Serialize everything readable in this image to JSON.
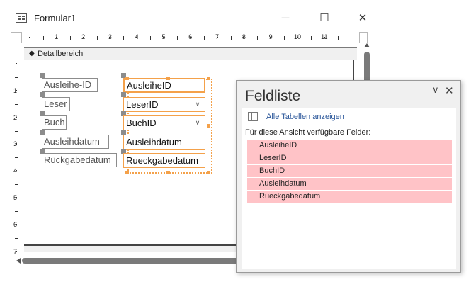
{
  "window": {
    "title": "Formular1",
    "minimize_glyph": "─",
    "maximize_glyph": "☐",
    "close_glyph": "✕"
  },
  "ruler": {
    "h_numbers": [
      "1",
      "2",
      "3",
      "4",
      "5",
      "6",
      "7",
      "8",
      "9",
      "10",
      "11"
    ],
    "v_numbers": [
      "1",
      "2",
      "3",
      "4",
      "5",
      "6",
      "7"
    ]
  },
  "section": {
    "label": "Detailbereich",
    "icon": "section-marker-icon"
  },
  "controls": [
    {
      "label": "Ausleihe-ID",
      "field": "AusleiheID",
      "dropdown": false,
      "selected": true
    },
    {
      "label": "Leser",
      "field": "LeserID",
      "dropdown": true,
      "selected": false
    },
    {
      "label": "Buch",
      "field": "BuchID",
      "dropdown": true,
      "selected": false
    },
    {
      "label": "Ausleihdatum",
      "field": "Ausleihdatum",
      "dropdown": false,
      "selected": false
    },
    {
      "label": "Rückgabedatum",
      "field": "Rueckgabedatum",
      "dropdown": false,
      "selected": false
    }
  ],
  "field_list": {
    "title": "Feldliste",
    "show_all_link": "Alle Tabellen anzeigen",
    "available_label": "Für diese Ansicht verfügbare Felder:",
    "fields": [
      "AusleiheID",
      "LeserID",
      "BuchID",
      "Ausleihdatum",
      "Rueckgabedatum"
    ],
    "highlight_color": "#ffc3c7"
  },
  "colors": {
    "selection": "#f4a14a",
    "window_border": "#b5475c",
    "link": "#2b579a"
  }
}
